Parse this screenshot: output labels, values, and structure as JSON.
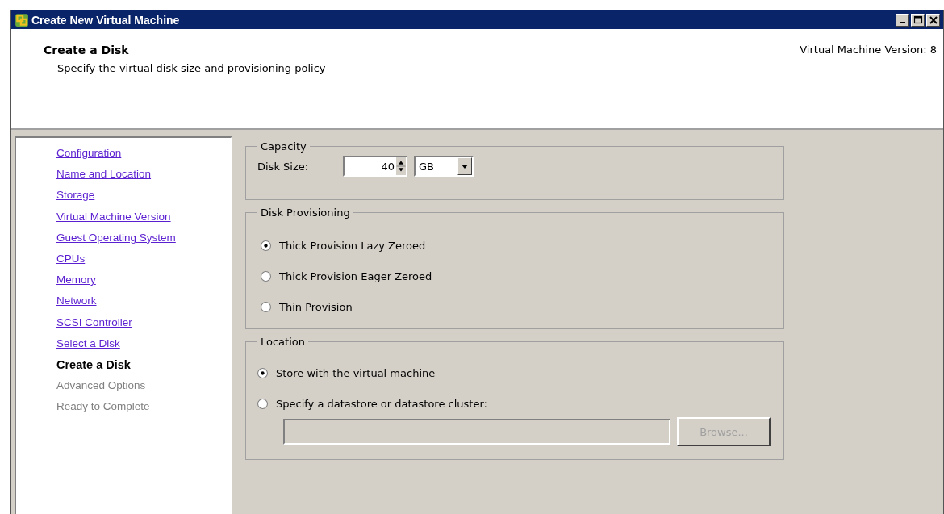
{
  "window": {
    "title": "Create New Virtual Machine"
  },
  "header": {
    "title": "Create a Disk",
    "subtitle": "Specify the virtual disk size and provisioning policy",
    "version": "Virtual Machine Version: 8"
  },
  "steps": [
    {
      "label": "Configuration",
      "selected": false,
      "disabled": false
    },
    {
      "label": "Name and Location",
      "selected": false,
      "disabled": false
    },
    {
      "label": "Storage",
      "selected": false,
      "disabled": false
    },
    {
      "label": "Virtual Machine Version",
      "selected": false,
      "disabled": false
    },
    {
      "label": "Guest Operating System",
      "selected": false,
      "disabled": false
    },
    {
      "label": "CPUs",
      "selected": false,
      "disabled": false
    },
    {
      "label": "Memory",
      "selected": false,
      "disabled": false
    },
    {
      "label": "Network",
      "selected": false,
      "disabled": false
    },
    {
      "label": "SCSI Controller",
      "selected": false,
      "disabled": false
    },
    {
      "label": "Select a Disk",
      "selected": false,
      "disabled": false
    },
    {
      "label": "Create a Disk",
      "selected": true,
      "disabled": false
    },
    {
      "label": "Advanced Options",
      "selected": false,
      "disabled": true
    },
    {
      "label": "Ready to Complete",
      "selected": false,
      "disabled": true
    }
  ],
  "capacity": {
    "title": "Capacity",
    "label": "Disk Size:",
    "value": "40",
    "unit": "GB"
  },
  "provisioning": {
    "title": "Disk Provisioning",
    "options": [
      {
        "label": "Thick Provision Lazy Zeroed",
        "selected": true
      },
      {
        "label": "Thick Provision Eager Zeroed",
        "selected": false
      },
      {
        "label": "Thin Provision",
        "selected": false
      }
    ]
  },
  "location": {
    "title": "Location",
    "options": [
      {
        "label": "Store with the virtual machine",
        "selected": true
      },
      {
        "label": "Specify a datastore or datastore cluster:",
        "selected": false
      }
    ],
    "path_disabled": true,
    "browse": {
      "label": "Browse...",
      "disabled": true
    }
  }
}
